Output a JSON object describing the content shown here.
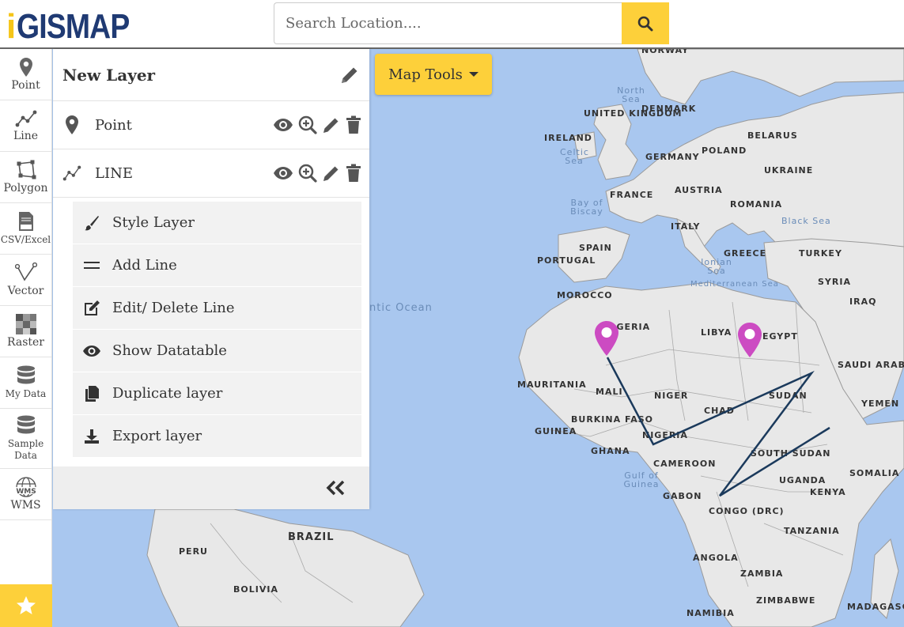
{
  "header": {
    "logo_i": "i",
    "logo_text": "GISMAP",
    "search_placeholder": "Search Location...."
  },
  "toolbar": {
    "items": [
      {
        "label": "Point",
        "icon": "map-marker-icon"
      },
      {
        "label": "Line",
        "icon": "polyline-icon"
      },
      {
        "label": "Polygon",
        "icon": "polygon-icon"
      },
      {
        "label": "CSV/Excel",
        "icon": "csv-file-icon"
      },
      {
        "label": "Vector",
        "icon": "vector-icon"
      },
      {
        "label": "Raster",
        "icon": "raster-icon"
      },
      {
        "label": "My Data",
        "icon": "database-icon"
      },
      {
        "label": "Sample Data",
        "icon": "database-icon"
      },
      {
        "label": "WMS",
        "icon": "globe-wms-icon"
      }
    ],
    "favorite_icon": "star-icon"
  },
  "panel": {
    "title": "New Layer",
    "layers": [
      {
        "name": "Point",
        "icon": "map-marker-icon"
      },
      {
        "name": "LINE",
        "icon": "polyline-icon"
      }
    ],
    "menu": [
      {
        "label": "Style Layer",
        "icon": "paint-brush-icon"
      },
      {
        "label": "Add Line",
        "icon": "equals-icon"
      },
      {
        "label": "Edit/ Delete Line",
        "icon": "edit-icon"
      },
      {
        "label": "Show Datatable",
        "icon": "eye-icon"
      },
      {
        "label": "Duplicate layer",
        "icon": "copy-icon"
      },
      {
        "label": "Export layer",
        "icon": "download-icon"
      }
    ]
  },
  "map_tools": {
    "label": "Map Tools"
  },
  "map": {
    "countries": [
      "NORWAY",
      "DENMARK",
      "UNITED KINGDOM",
      "IRELAND",
      "GERMANY",
      "POLAND",
      "BELARUS",
      "UKRAINE",
      "FRANCE",
      "AUSTRIA",
      "ROMANIA",
      "ITALY",
      "SPAIN",
      "PORTUGAL",
      "GREECE",
      "TURKEY",
      "SYRIA",
      "IRAQ",
      "MOROCCO",
      "ALGERIA",
      "LIBYA",
      "EGYPT",
      "SAUDI ARABIA",
      "YEMEN",
      "MAURITANIA",
      "MALI",
      "NIGER",
      "SUDAN",
      "CHAD",
      "BURKINA FASO",
      "GUINEA",
      "NIGERIA",
      "GHANA",
      "CAMEROON",
      "SOUTH SUDAN",
      "SOMALIA",
      "GABON",
      "UGANDA",
      "KENYA",
      "CONGO (DRC)",
      "TANZANIA",
      "ANGOLA",
      "ZAMBIA",
      "ZIMBABWE",
      "NAMIBIA",
      "MADAGASCAR",
      "BRAZIL",
      "PERU",
      "BOLIVIA"
    ],
    "seas": [
      "North Sea",
      "Celtic Sea",
      "Bay of Biscay",
      "Black Sea",
      "Ionian Sea",
      "Mediterranean Sea",
      "Gulf of Guinea"
    ],
    "ocean": "ntic Ocean",
    "colors": {
      "water": "#a9c7ef",
      "land": "#e8e8e8",
      "line": "#1b3a5c",
      "marker": "#cc4bc2",
      "accent": "#fdd03a"
    }
  }
}
